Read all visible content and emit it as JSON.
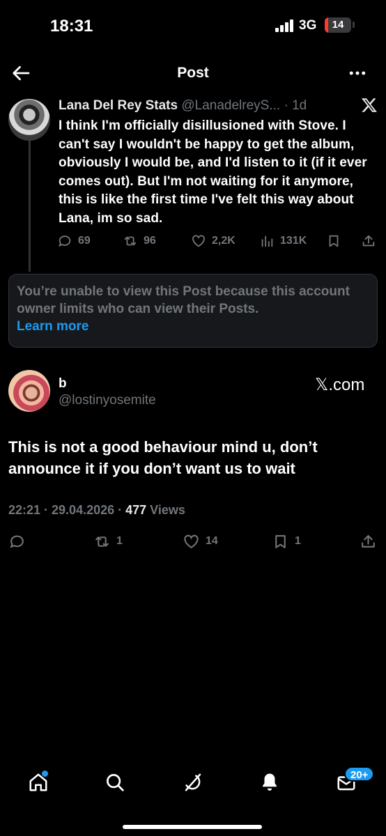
{
  "status_bar": {
    "time": "18:31",
    "network": "3G",
    "battery": "14",
    "battery_level": 0.14,
    "battery_color": "#ff3b30"
  },
  "header": {
    "title": "Post",
    "back_icon": "arrow-left-icon",
    "more_icon": "more-horizontal-icon"
  },
  "quoted_post": {
    "author_name": "Lana Del Rey Stats",
    "author_handle": "@LanadelreyS...",
    "time": "· 1d",
    "platform_icon": "x-logo-icon",
    "text": "I think I'm officially disillusioned with Stove. I can't say I wouldn't be happy to get the album, obviously I would be, and I'd listen to it (if it ever comes out). But I'm not waiting for it anymore, this is like the first time I've felt this way about Lana, im so sad.",
    "replies": "69",
    "reposts": "96",
    "likes": "2,2K",
    "views": "131K"
  },
  "unavailable_notice": {
    "text": "You’re unable to view this Post because this account owner limits who can view their Posts.",
    "link": "Learn more"
  },
  "main_post": {
    "author_name": "b",
    "author_handle": "@lostinyosemite",
    "source": "𝕏.com",
    "text": "This is not a good behaviour mind u, don’t announce it if you don’t want us to wait",
    "datetime": "22:21 · 29.04.2026 · ",
    "views_count": "477",
    "views_label": " Views",
    "replies": "",
    "reposts": "1",
    "likes": "14",
    "bookmarks": "1"
  },
  "bottom_nav": {
    "items": [
      "home-icon",
      "search-icon",
      "grok-icon",
      "notifications-icon",
      "messages-icon"
    ],
    "messages_badge": "20+"
  },
  "colors": {
    "background": "#000000",
    "muted": "#71767b",
    "accent": "#1d9bf0",
    "border": "#2f3336"
  }
}
